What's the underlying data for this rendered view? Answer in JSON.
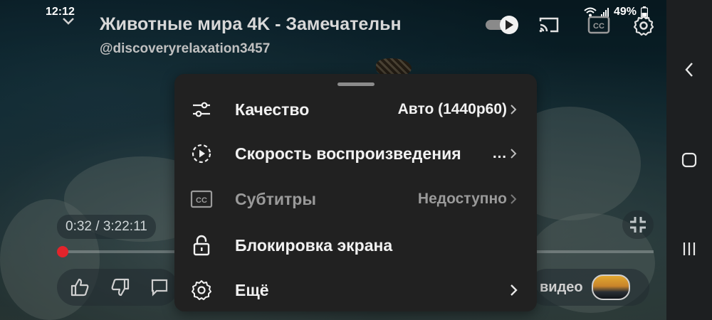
{
  "status_bar": {
    "time": "12:12",
    "battery": "49%"
  },
  "player": {
    "title": "Животные мира 4K - Замечательн",
    "channel": "@discoveryrelaxation3457",
    "time_display": "0:32 / 3:22:11",
    "progress_fraction": 0.0027,
    "cc_label": "CC",
    "next_video_label": "видео"
  },
  "settings_menu": {
    "items": [
      {
        "label": "Качество",
        "value": "Авто (1440p60)"
      },
      {
        "label": "Скорость воспроизведения",
        "value": "…"
      },
      {
        "label": "Субтитры",
        "value": "Недоступно"
      },
      {
        "label": "Блокировка экрана",
        "value": ""
      },
      {
        "label": "Ещё",
        "value": ""
      }
    ]
  },
  "icons": {
    "status": [
      "wifi-icon",
      "signal-icon",
      "battery-icon"
    ],
    "top": [
      "collapse-chevron-icon",
      "autoplay-toggle",
      "cast-icon",
      "captions-icon",
      "settings-gear-icon"
    ],
    "menu": [
      "sliders-icon",
      "playback-speed-icon",
      "captions-icon",
      "lock-icon",
      "gear-icon"
    ],
    "nav": [
      "back-chevron-icon",
      "home-icon",
      "recent-apps-icon"
    ]
  },
  "colors": {
    "sheet_bg": "#212121",
    "progress_red": "#e3242b",
    "nav_bg": "#1d1f21"
  }
}
